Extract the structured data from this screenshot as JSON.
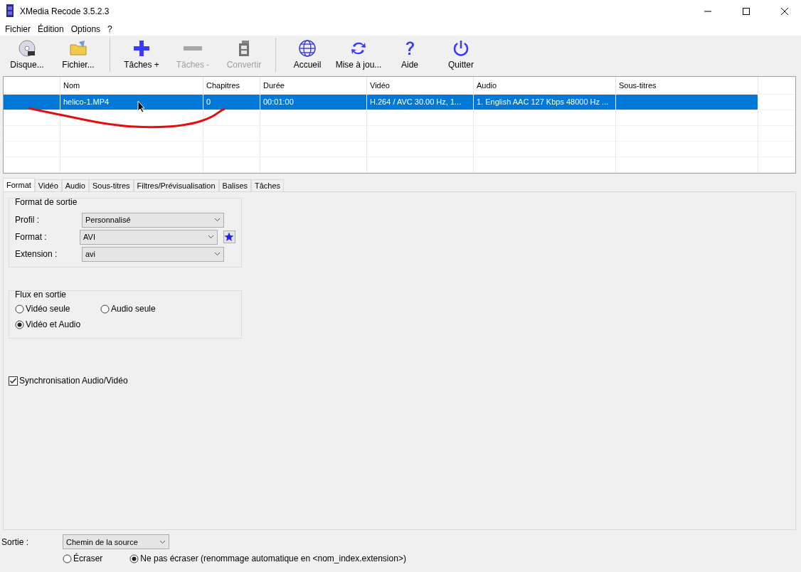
{
  "window": {
    "title": "XMedia Recode 3.5.2.3"
  },
  "menu": [
    "Fichier",
    "Édition",
    "Options",
    "?"
  ],
  "toolbar": [
    {
      "label": "Disque...",
      "kind": "disc",
      "disabled": false
    },
    {
      "label": "Fichier...",
      "kind": "folder",
      "disabled": false
    },
    {
      "kind": "separator"
    },
    {
      "label": "Tâches +",
      "kind": "plus",
      "disabled": false
    },
    {
      "label": "Tâches -",
      "kind": "minus",
      "disabled": true
    },
    {
      "label": "Convertir",
      "kind": "film",
      "disabled": true
    },
    {
      "kind": "separator"
    },
    {
      "label": "Accueil",
      "kind": "globe",
      "disabled": false
    },
    {
      "label": "Mise à jou...",
      "kind": "refresh",
      "disabled": false
    },
    {
      "label": "Aide",
      "kind": "help",
      "disabled": false
    },
    {
      "label": "Quitter",
      "kind": "power",
      "disabled": false
    }
  ],
  "table": {
    "columns": [
      "",
      "Nom",
      "Chapitres",
      "Durée",
      "Vidéo",
      "Audio",
      "Sous-titres"
    ],
    "rows": [
      {
        "selected": true,
        "cells": [
          "",
          "helico-1.MP4",
          "0",
          "00:01:00",
          "H.264 / AVC  30.00 Hz, 1...",
          "1. English AAC  127 Kbps 48000 Hz ...",
          ""
        ]
      }
    ]
  },
  "tabs": [
    {
      "label": "Format",
      "selected": true
    },
    {
      "label": "Vidéo",
      "selected": false
    },
    {
      "label": "Audio",
      "selected": false
    },
    {
      "label": "Sous-titres",
      "selected": false
    },
    {
      "label": "Filtres/Prévisualisation",
      "selected": false
    },
    {
      "label": "Balises",
      "selected": false
    },
    {
      "label": "Tâches",
      "selected": false
    }
  ],
  "format_group": {
    "title": "Format de sortie",
    "fields": [
      {
        "label": "Profil :",
        "value": "Personnalisé",
        "favorite": false
      },
      {
        "label": "Format :",
        "value": "AVI",
        "favorite": true
      },
      {
        "label": "Extension :",
        "value": "avi",
        "favorite": false
      }
    ]
  },
  "stream_group": {
    "title": "Flux en sortie",
    "options": [
      {
        "label": "Vidéo seule",
        "selected": false
      },
      {
        "label": "Audio seule",
        "selected": false
      },
      {
        "label": "Vidéo et Audio",
        "selected": true
      }
    ]
  },
  "sync_checkbox": {
    "label": "Synchronisation Audio/Vidéo",
    "checked": true
  },
  "output": {
    "label": "Sortie :",
    "value": "Chemin de la source",
    "options": [
      {
        "label": "Écraser",
        "selected": false
      },
      {
        "label": "Ne pas écraser (renommage automatique en <nom_index.extension>)",
        "selected": true
      }
    ]
  }
}
